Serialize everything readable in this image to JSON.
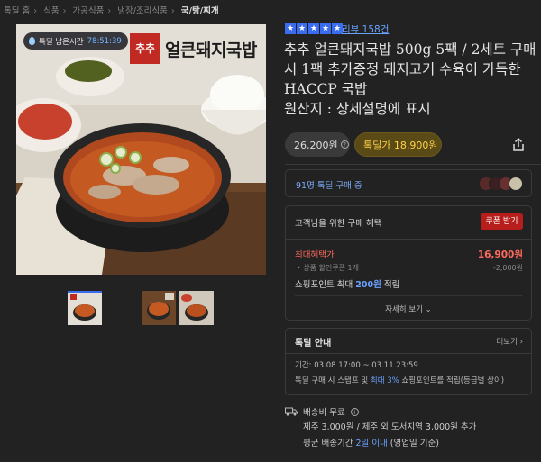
{
  "breadcrumb": [
    "톡딜 홈",
    "식품",
    "가공식품",
    "냉장/조리식품",
    "국/탕/찌개"
  ],
  "timer": {
    "label": "톡딜 남은시간",
    "time": "78:51:39"
  },
  "brand": {
    "mark": "추추",
    "name": "얼큰돼지국밥"
  },
  "rating": {
    "stars": 5,
    "reviews": "리뷰 158건"
  },
  "product": {
    "title": "추추 얼큰돼지국밥 500g 5팩 / 2세트 구매시 1팩 추가증정 돼지고기 수육이 가득한 HACCP 국밥",
    "origin": "원산지 : 상세설명에 표시"
  },
  "price": {
    "original": "26,200원",
    "deal_label": "톡딜가",
    "deal": "18,900원"
  },
  "buyers": {
    "text": "91명 톡딜 구매 중"
  },
  "benefit": {
    "header": "고객님을 위한 구매 혜택",
    "coupon_button": "쿠폰 받기",
    "max_label": "최대혜택가",
    "max_value": "16,900원",
    "sub_label": "• 상품 할인쿠폰 1개",
    "sub_value": "-2,000원",
    "points_prefix": "쇼핑포인트 최대 ",
    "points_value": "200원",
    "points_suffix": " 적립",
    "more": "자세히 보기 ⌄"
  },
  "guide": {
    "header": "톡딜 안내",
    "more": "더보기 ›",
    "period": "기간: 03.08 17:00 ~ 03.11 23:59",
    "note_prefix": "톡딜 구매 시 스탬프 및 ",
    "note_hl": "최대 3%",
    "note_suffix": " 쇼핑포인트를 적립(등급별 상이)"
  },
  "shipping": {
    "fee": "배송비 무료",
    "extra": "제주 3,000원 / 제주 외 도서지역 3,000원 추가",
    "avg_prefix": "평균 배송기간 ",
    "avg_hl": "2일 이내",
    "avg_suffix": " (영업일 기준)"
  },
  "colors": {
    "accent_blue": "#3a6cf0",
    "deal_yellow": "#ffd24a",
    "coupon_red": "#b71d1a",
    "highlight_red": "#ff6a5e"
  }
}
